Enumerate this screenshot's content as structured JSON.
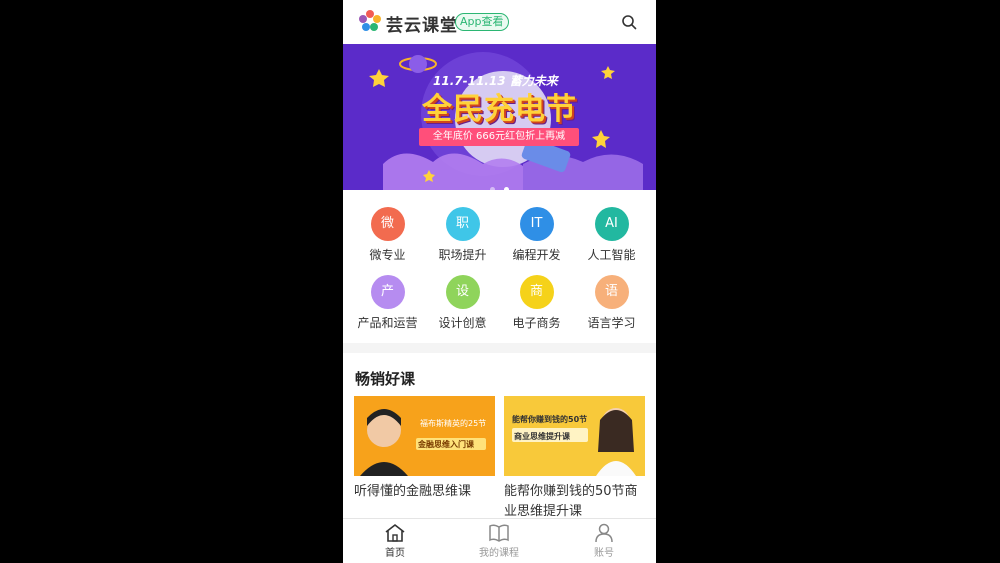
{
  "header": {
    "brand": "芸云课堂",
    "app_badge": "App查看"
  },
  "banner": {
    "top_text": "11.7-11.13 蓄力未来",
    "title": "全民充电节",
    "subtitle": "全年底价 666元红包折上再减"
  },
  "categories": [
    {
      "label": "微专业",
      "glyph": "微",
      "color": "#f26b4f"
    },
    {
      "label": "职场提升",
      "glyph": "职",
      "color": "#3fc6e8"
    },
    {
      "label": "编程开发",
      "glyph": "IT",
      "color": "#2f8fe6"
    },
    {
      "label": "人工智能",
      "glyph": "AI",
      "color": "#22b8a0"
    },
    {
      "label": "产品和运营",
      "glyph": "产",
      "color": "#b68cf0"
    },
    {
      "label": "设计创意",
      "glyph": "设",
      "color": "#8fd45b"
    },
    {
      "label": "电子商务",
      "glyph": "商",
      "color": "#f5d21a"
    },
    {
      "label": "语言学习",
      "glyph": "语",
      "color": "#f7b07a"
    }
  ],
  "section": {
    "title": "畅销好课"
  },
  "courses": [
    {
      "name": "听得懂的金融思维课",
      "img_line1": "福布斯精英的25节",
      "img_line2": "金融思维入门课"
    },
    {
      "name": "能帮你赚到钱的50节商业思维提升课",
      "img_line1": "能帮你赚到钱的50节",
      "img_line2": "商业思维提升课"
    }
  ],
  "tabbar": [
    {
      "label": "首页",
      "icon": "home-icon"
    },
    {
      "label": "我的课程",
      "icon": "book-icon"
    },
    {
      "label": "账号",
      "icon": "user-icon"
    }
  ]
}
